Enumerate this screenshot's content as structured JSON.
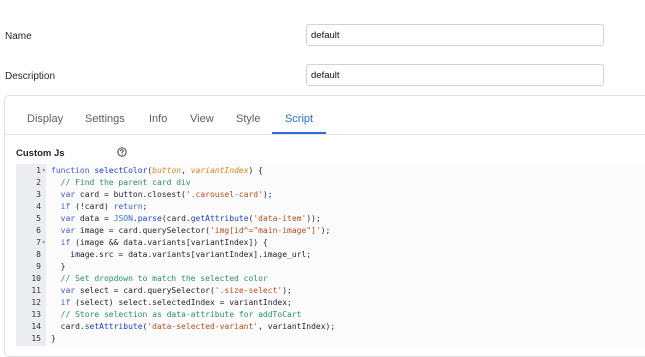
{
  "form": {
    "name": {
      "label": "Name",
      "value": "default"
    },
    "description": {
      "label": "Description",
      "value": "default"
    }
  },
  "tabs": [
    {
      "label": "Display",
      "active": false
    },
    {
      "label": "Settings",
      "active": false
    },
    {
      "label": "Info",
      "active": false
    },
    {
      "label": "View",
      "active": false
    },
    {
      "label": "Style",
      "active": false
    },
    {
      "label": "Script",
      "active": true
    }
  ],
  "custom_js": {
    "label": "Custom Js",
    "help_icon": "question-circle-icon",
    "accent_color": "#2f6fd0",
    "code_lines": [
      {
        "n": "1",
        "fold": true,
        "tokens": [
          [
            "kw",
            "function "
          ],
          [
            "fn",
            "selectColor"
          ],
          [
            "pl",
            "("
          ],
          [
            "param",
            "button"
          ],
          [
            "pl",
            ", "
          ],
          [
            "param",
            "variantIndex"
          ],
          [
            "pl",
            ") {"
          ]
        ]
      },
      {
        "n": "2",
        "fold": false,
        "tokens": [
          [
            "cm",
            "  // Find the parent card div"
          ]
        ]
      },
      {
        "n": "3",
        "fold": false,
        "tokens": [
          [
            "kw",
            "  var "
          ],
          [
            "pl",
            "card = button.closest("
          ],
          [
            "str",
            "'.carousel-card'"
          ],
          [
            "pl",
            ");"
          ]
        ]
      },
      {
        "n": "4",
        "fold": false,
        "tokens": [
          [
            "kw",
            "  if "
          ],
          [
            "pl",
            "(!card) "
          ],
          [
            "kw",
            "return"
          ],
          [
            "pl",
            ";"
          ]
        ]
      },
      {
        "n": "5",
        "fold": false,
        "tokens": [
          [
            "kw",
            "  var "
          ],
          [
            "pl",
            "data = "
          ],
          [
            "obj",
            "JSON"
          ],
          [
            "pl",
            "."
          ],
          [
            "fn",
            "parse"
          ],
          [
            "pl",
            "(card."
          ],
          [
            "fn",
            "getAttribute"
          ],
          [
            "pl",
            "("
          ],
          [
            "str",
            "'data-item'"
          ],
          [
            "pl",
            "));"
          ]
        ]
      },
      {
        "n": "6",
        "fold": false,
        "tokens": [
          [
            "kw",
            "  var "
          ],
          [
            "pl",
            "image = card.querySelector("
          ],
          [
            "str",
            "'img[id^=\"main-image\"]'"
          ],
          [
            "pl",
            ");"
          ]
        ]
      },
      {
        "n": "7",
        "fold": true,
        "tokens": [
          [
            "kw",
            "  if "
          ],
          [
            "pl",
            "(image && data.variants[variantIndex]) {"
          ]
        ]
      },
      {
        "n": "8",
        "fold": false,
        "tokens": [
          [
            "pl",
            "    image.src = data.variants[variantIndex].image_url;"
          ]
        ]
      },
      {
        "n": "9",
        "fold": false,
        "tokens": [
          [
            "pl",
            "  }"
          ]
        ]
      },
      {
        "n": "10",
        "fold": false,
        "tokens": [
          [
            "cm",
            "  // Set dropdown to match the selected color"
          ]
        ]
      },
      {
        "n": "11",
        "fold": false,
        "tokens": [
          [
            "kw",
            "  var "
          ],
          [
            "pl",
            "select = card.querySelector("
          ],
          [
            "str",
            "'.size-select'"
          ],
          [
            "pl",
            ");"
          ]
        ]
      },
      {
        "n": "12",
        "fold": false,
        "tokens": [
          [
            "kw",
            "  if "
          ],
          [
            "pl",
            "(select) select.selectedIndex = variantIndex;"
          ]
        ]
      },
      {
        "n": "13",
        "fold": false,
        "tokens": [
          [
            "cm",
            "  // Store selection as data-attribute for addToCart"
          ]
        ]
      },
      {
        "n": "14",
        "fold": false,
        "tokens": [
          [
            "pl",
            "  card."
          ],
          [
            "fn",
            "setAttribute"
          ],
          [
            "pl",
            "("
          ],
          [
            "str",
            "'data-selected-variant'"
          ],
          [
            "pl",
            ", variantIndex);"
          ]
        ]
      },
      {
        "n": "15",
        "fold": false,
        "tokens": [
          [
            "pl",
            "}"
          ]
        ]
      }
    ]
  }
}
